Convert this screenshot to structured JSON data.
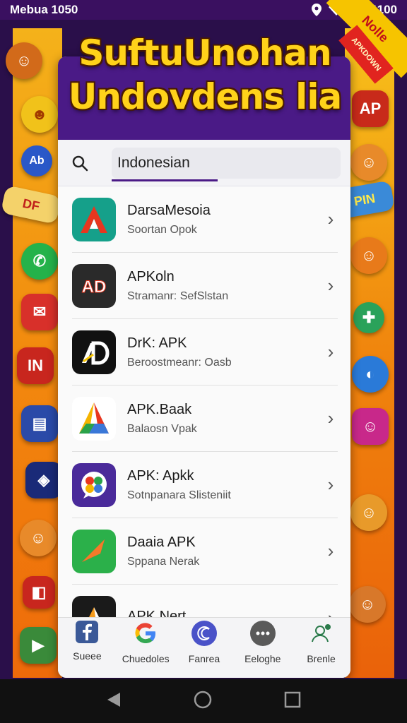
{
  "status_bar": {
    "left_text": "Mebua 1050",
    "time": "1100"
  },
  "ribbon": {
    "main": "Nolle",
    "secondary": "APKDOWN"
  },
  "headline": {
    "line1": "SuftuUnohan",
    "line2": "Undovdens lia"
  },
  "search": {
    "value": "Indonesian",
    "icon": "search-icon"
  },
  "apps": [
    {
      "name": "DarsaMesoia",
      "subtitle": "Soortan Opok",
      "icon": "red-a-logo-icon",
      "color": "#15a08a"
    },
    {
      "name": "APKoln",
      "subtitle": "Stramanr: SefSlstan",
      "icon": "apk-letters-icon",
      "color": "#2a2a2a"
    },
    {
      "name": "DrK: APK",
      "subtitle": "Beroostmeanr: Oasb",
      "icon": "ad-monogram-icon",
      "color": "#111111"
    },
    {
      "name": "APK.Baak",
      "subtitle": "Balaosn Vpak",
      "icon": "triangle-logo-icon",
      "color": "#ffffff"
    },
    {
      "name": "APK: Apkk",
      "subtitle": "Sotnpanara Slisteniit",
      "icon": "puzzle-bubble-icon",
      "color": "#4a2a9a"
    },
    {
      "name": "Daaia APK",
      "subtitle": "Sppana Nerak",
      "icon": "green-arrow-icon",
      "color": "#2bb04a"
    },
    {
      "name": "APK Nert",
      "subtitle": "",
      "icon": "orange-wedge-icon",
      "color": "#1a1a1a"
    }
  ],
  "bottom_nav": [
    {
      "label": "Sueee",
      "icon": "facebook-icon",
      "color": "#3b5998"
    },
    {
      "label": "Chuedoles",
      "icon": "google-icon",
      "color": "#ffffff"
    },
    {
      "label": "Fanrea",
      "icon": "crescent-icon",
      "color": "#4a52c8"
    },
    {
      "label": "Eeloghe",
      "icon": "chat-dots-icon",
      "color": "#5a5a5a"
    },
    {
      "label": "Brenle",
      "icon": "profile-add-icon",
      "color": "#ffffff"
    }
  ],
  "side_deco_left": [
    "DF",
    "Ab",
    "IN"
  ],
  "side_deco_right": [
    "AP",
    "APK",
    "PIN"
  ]
}
